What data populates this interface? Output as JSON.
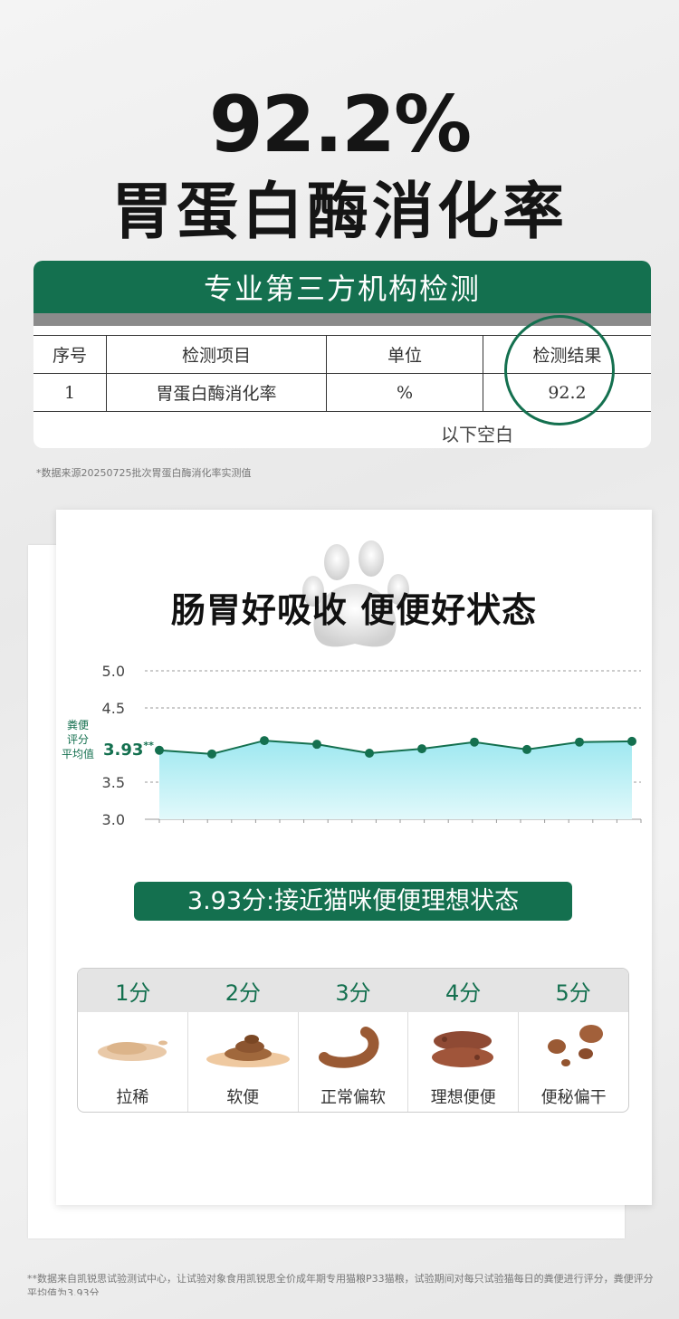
{
  "headline": {
    "number": "92.2%",
    "subtitle": "胃蛋白酶消化率"
  },
  "report": {
    "header": "专业第三方机构检测",
    "columns": [
      "序号",
      "检测项目",
      "单位",
      "检测结果"
    ],
    "row": [
      "1",
      "胃蛋白酶消化率",
      "%",
      "92.2"
    ],
    "blank_note": "以下空白"
  },
  "footnote_source": "*数据来源20250725批次胃蛋白酶消化率实测值",
  "card": {
    "title": "肠胃好吸收 便便好状态",
    "avg_label": [
      "粪便",
      "评分",
      "平均值"
    ],
    "avg_value": "3.93",
    "avg_mark": "**",
    "summary": "3.93分:接近猫咪便便理想状态",
    "scores": [
      {
        "score": "1分",
        "desc": "拉稀",
        "icon": "loose-stool-icon"
      },
      {
        "score": "2分",
        "desc": "软便",
        "icon": "soft-stool-icon"
      },
      {
        "score": "3分",
        "desc": "正常偏软",
        "icon": "normal-soft-stool-icon"
      },
      {
        "score": "4分",
        "desc": "理想便便",
        "icon": "ideal-stool-icon"
      },
      {
        "score": "5分",
        "desc": "便秘偏干",
        "icon": "dry-stool-icon"
      }
    ]
  },
  "chart_data": {
    "type": "area",
    "ylim": [
      3.0,
      5.0
    ],
    "yticks": [
      "5.0",
      "4.5",
      "3.5",
      "3.0"
    ],
    "y": [
      3.93,
      3.88,
      4.06,
      4.01,
      3.89,
      3.95,
      4.04,
      3.94,
      4.04,
      4.05
    ],
    "grid": true,
    "colors": {
      "line": "#14704f",
      "fill_top": "#9ee8f0",
      "fill_bottom": "#e2f9fb"
    }
  },
  "footnote_method": "**数据来自凯锐思试验测试中心，让试验对象食用凯锐思全价成年期专用猫粮P33猫粮，试验期间对每只试验猫每日的粪便进行评分，粪便评分平均值为3.93分",
  "colors": {
    "brand_green": "#14704f"
  }
}
